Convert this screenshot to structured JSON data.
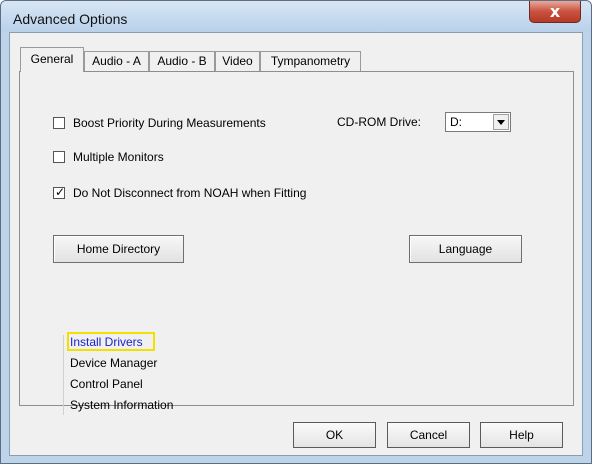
{
  "window": {
    "title": "Advanced Options",
    "close_label": "x"
  },
  "tabs": [
    {
      "label": "General",
      "active": true
    },
    {
      "label": "Audio - A",
      "active": false
    },
    {
      "label": "Audio - B",
      "active": false
    },
    {
      "label": "Video",
      "active": false
    },
    {
      "label": "Tympanometry",
      "active": false
    }
  ],
  "general": {
    "checkboxes": [
      {
        "label": "Boost Priority During Measurements",
        "checked": false
      },
      {
        "label": "Multiple Monitors",
        "checked": false
      },
      {
        "label": "Do Not Disconnect from NOAH when Fitting",
        "checked": true
      }
    ],
    "check_mark": "✓",
    "cdrom": {
      "label": "CD-ROM Drive:",
      "value": "D:"
    },
    "home_directory_label": "Home Directory",
    "language_label": "Language",
    "links": [
      "Install Drivers",
      "Device Manager",
      "Control Panel",
      "System Information"
    ]
  },
  "footer": {
    "ok_label": "OK",
    "cancel_label": "Cancel",
    "help_label": "Help"
  },
  "colors": {
    "link_highlight_text": "#1a22c9",
    "highlight_box": "#f2e000",
    "title_bar": "#bcd3ea",
    "close_button": "#c8523f"
  }
}
